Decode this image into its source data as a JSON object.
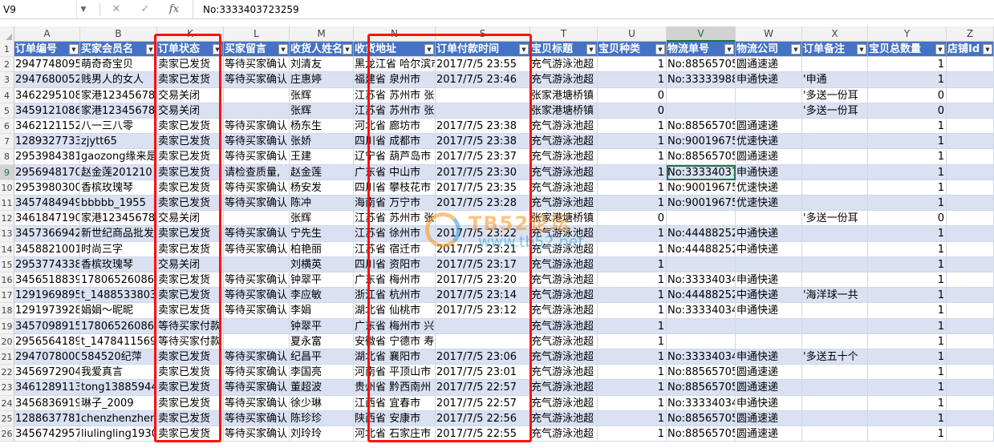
{
  "formula_bar": {
    "name_box": "V9",
    "fx_label": "fx",
    "content": "No:3333403723259"
  },
  "columns": [
    "A",
    "B",
    "K",
    "L",
    "M",
    "N",
    "S",
    "T",
    "U",
    "V",
    "W",
    "X",
    "Y",
    "Z"
  ],
  "selected_column": "V",
  "headers": [
    "订单编号",
    "买家会员名",
    "订单状态",
    "买家留言",
    "收货人姓名",
    "收货地址",
    "订单付款时间",
    "宝贝标题",
    "宝贝种类",
    "物流单号",
    "物流公司",
    "订单备注",
    "宝贝总数量",
    "店铺Id"
  ],
  "rows": [
    {
      "n": "2",
      "cells": [
        "2947748095",
        "萌奇奇宝贝",
        "卖家已发货",
        "等待买家确认",
        "刘清友",
        "黑龙江省 哈尔滨市",
        "2017/7/5 23:55",
        "充气游泳池超",
        "1",
        "No:8856570511",
        "圆通速递",
        "",
        "1",
        ""
      ]
    },
    {
      "n": "3",
      "cells": [
        "2947680052",
        "贱男人的女人",
        "卖家已发货",
        "等待买家确认",
        "庄惠婷",
        "福建省 泉州市",
        "2017/7/5 23:46",
        "充气游泳池超",
        "1",
        "No:3333398866",
        "申通快递",
        "'申通",
        "1",
        ""
      ]
    },
    {
      "n": "4",
      "cells": [
        "3462295108",
        "家港12345678",
        "交易关闭",
        "",
        "张辉",
        "江苏省 苏州市 张家港市 塘桥镇",
        "",
        "张家港塘桥镇",
        "0",
        "",
        "",
        "'多送一份耳",
        "0",
        ""
      ]
    },
    {
      "n": "5",
      "cells": [
        "3459121086",
        "家港12345678",
        "交易关闭",
        "",
        "张辉",
        "江苏省 苏州市 张家港市 塘桥镇",
        "",
        "张家港塘桥镇",
        "0",
        "",
        "",
        "'多送一份耳",
        "0",
        ""
      ]
    },
    {
      "n": "6",
      "cells": [
        "3462121152",
        "八一三八零",
        "卖家已发货",
        "等待买家确认",
        "杨东生",
        "河北省 廊坊市",
        "2017/7/5 23:38",
        "充气游泳池超",
        "1",
        "No:8856570511",
        "圆通速递",
        "",
        "1",
        ""
      ]
    },
    {
      "n": "7",
      "cells": [
        "1289327733",
        "zjytt65",
        "卖家已发货",
        "等待买家确认",
        "张娇",
        "四川省 成都市",
        "2017/7/5 23:38",
        "充气游泳池超",
        "1",
        "No:9001967511",
        "优速快递",
        "",
        "1",
        ""
      ]
    },
    {
      "n": "8",
      "cells": [
        "2953984381",
        "gaozong缘来是你",
        "卖家已发货",
        "等待买家确认",
        "王建",
        "辽宁省 葫芦岛市",
        "2017/7/5 23:37",
        "充气游泳池超",
        "1",
        "No:8856570511",
        "圆通速递",
        "",
        "1",
        ""
      ]
    },
    {
      "n": "9",
      "cells": [
        "2956948170",
        "赵金莲201210",
        "卖家已发货",
        "请检查质量,",
        "赵金莲",
        "广东省 中山市",
        "2017/7/5 23:30",
        "充气游泳池超",
        "1",
        "No:3333403723259",
        "申通快递",
        "",
        "1",
        ""
      ]
    },
    {
      "n": "10",
      "cells": [
        "2953980300",
        "香槟玫瑰琴",
        "卖家已发货",
        "等待买家确认",
        "杨安发",
        "四川省 攀枝花市",
        "2017/7/5 23:35",
        "充气游泳池超",
        "1",
        "No:9001967511",
        "优速快递",
        "",
        "1",
        ""
      ]
    },
    {
      "n": "11",
      "cells": [
        "3457484949",
        "bbbbb_1955",
        "卖家已发货",
        "等待买家确认",
        "陈冲",
        "海南省 万宁市",
        "2017/7/5 23:28",
        "充气游泳池超",
        "1",
        "No:9001967511",
        "优速快递",
        "",
        "1",
        ""
      ]
    },
    {
      "n": "12",
      "cells": [
        "3461847190",
        "家港12345678",
        "交易关闭",
        "",
        "张辉",
        "江苏省 苏州市 张家港市 塘桥镇",
        "",
        "张家港塘桥镇",
        "0",
        "",
        "",
        "'多送一份耳",
        "0",
        ""
      ]
    },
    {
      "n": "13",
      "cells": [
        "3457366942",
        "新世纪商品批发",
        "卖家已发货",
        "等待买家确认",
        "宁先生",
        "江苏省 徐州市",
        "2017/7/5 23:22",
        "充气游泳池超",
        "1",
        "No:4448825211",
        "中通快递",
        "",
        "1",
        ""
      ]
    },
    {
      "n": "14",
      "cells": [
        "3458821001",
        "时尚三字",
        "卖家已发货",
        "等待买家确认",
        "柏艳丽",
        "江苏省 宿迁市",
        "2017/7/5 23:21",
        "充气游泳池超",
        "1",
        "No:4448825211",
        "中通快递",
        "",
        "1",
        ""
      ]
    },
    {
      "n": "15",
      "cells": [
        "2953774338",
        "香槟玫瑰琴",
        "交易关闭",
        "",
        "刘横英",
        "四川省 资阳市",
        "2017/7/5 23:17",
        "充气游泳池超",
        "1",
        "",
        "",
        "",
        "1",
        ""
      ]
    },
    {
      "n": "16",
      "cells": [
        "3456518839",
        "17806526086",
        "卖家已发货",
        "等待买家确认",
        "钟翠平",
        "广东省 梅州市",
        "2017/7/5 23:20",
        "充气游泳池超",
        "1",
        "No:3333403411",
        "申通快递",
        "",
        "1",
        ""
      ]
    },
    {
      "n": "17",
      "cells": [
        "1291969895",
        "t_1488533803",
        "卖家已发货",
        "等待买家确认",
        "李应敏",
        "浙江省 杭州市",
        "2017/7/5 23:14",
        "充气游泳池超",
        "1",
        "No:4448825211",
        "中通快递",
        "'海洋球一共",
        "1",
        ""
      ]
    },
    {
      "n": "18",
      "cells": [
        "1291973928",
        "娟娟～昵昵",
        "卖家已发货",
        "等待买家确认",
        "李娟",
        "湖北省 仙桃市",
        "2017/7/5 23:12",
        "充气游泳池超",
        "1",
        "No:3333403411",
        "申通快递",
        "",
        "1",
        ""
      ]
    },
    {
      "n": "19",
      "cells": [
        "3457098915",
        "17806526086",
        "等待买家付款",
        "",
        "钟翠平",
        "广东省 梅州市 兴宁市 黄陂镇,",
        "",
        "充气游泳池超",
        "1",
        "",
        "",
        "",
        "1",
        ""
      ]
    },
    {
      "n": "20",
      "cells": [
        "2956564189",
        "t_1478411569",
        "等待买家付款",
        "",
        "夏永富",
        "安徽省 宁德市 寿宁县 南阳镇福",
        "",
        "充气游泳池超",
        "1",
        "",
        "",
        "",
        "1",
        ""
      ]
    },
    {
      "n": "21",
      "cells": [
        "2947078000",
        "584520纪萍",
        "卖家已发货",
        "等待买家确认",
        "纪昌平",
        "湖北省 襄阳市",
        "2017/7/5 23:06",
        "充气游泳池超",
        "1",
        "No:3333403411",
        "申通快递",
        "'多送五十个",
        "1",
        ""
      ]
    },
    {
      "n": "22",
      "cells": [
        "3456972904",
        "我爱真言",
        "卖家已发货",
        "等待买家确认",
        "李国亮",
        "河南省 平顶山市",
        "2017/7/5 23:01",
        "充气游泳池超",
        "1",
        "No:8856570511",
        "圆通速递",
        "",
        "1",
        ""
      ]
    },
    {
      "n": "23",
      "cells": [
        "3461289113",
        "tong13885944",
        "卖家已发货",
        "等待买家确认",
        "董超波",
        "贵州省 黔西南州",
        "2017/7/5 22:57",
        "充气游泳池超",
        "1",
        "No:8856570511",
        "圆通速递",
        "",
        "1",
        ""
      ]
    },
    {
      "n": "24",
      "cells": [
        "3456836919",
        "琳子_2009",
        "卖家已发货",
        "等待买家确认",
        "徐少琳",
        "江西省 宜春市",
        "2017/7/5 22:57",
        "充气游泳池超",
        "1",
        "No:3333403411",
        "申通快递",
        "",
        "1",
        ""
      ]
    },
    {
      "n": "25",
      "cells": [
        "1288637781",
        "chenzhenzhen",
        "卖家已发货",
        "等待买家确认",
        "陈珍珍",
        "陕西省 安康市",
        "2017/7/5 22:56",
        "充气游泳池超",
        "1",
        "No:8856570511",
        "圆通速递",
        "",
        "1",
        ""
      ]
    },
    {
      "n": "26",
      "cells": [
        "3456742957",
        "liulingling1930",
        "卖家已发货",
        "等待买家确认",
        "刘玲玲",
        "河北省 石家庄市",
        "2017/7/5 22:55",
        "充气游泳池超",
        "1",
        "No:8856570511",
        "圆通速递",
        "",
        "1",
        ""
      ]
    }
  ],
  "watermark": {
    "t1": "TB52论坛",
    "t2": "www.tb52.net"
  }
}
